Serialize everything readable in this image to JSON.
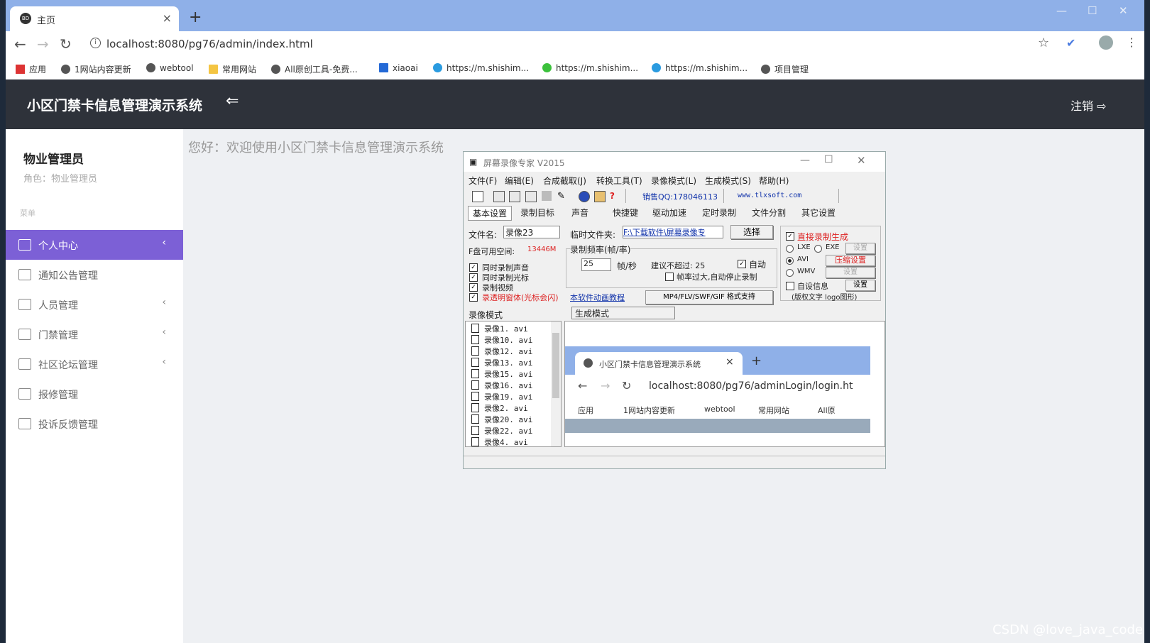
{
  "browser": {
    "tab_title": "主页",
    "tab_favicon": "BD",
    "url": "localhost:8080/pg76/admin/index.html",
    "bookmarks": [
      "应用",
      "1网站内容更新",
      "webtool",
      "常用网站",
      "All原创工具-免费...",
      "xiaoai",
      "https://m.shishim...",
      "https://m.shishim...",
      "https://m.shishim...",
      "项目管理"
    ]
  },
  "app": {
    "title": "小区门禁卡信息管理演示系统",
    "logout": "注销",
    "user_name": "物业管理员",
    "user_role": "角色：物业管理员",
    "menu_label": "菜单",
    "menu": [
      {
        "label": "个人中心",
        "chevron": true,
        "active": true
      },
      {
        "label": "通知公告管理",
        "chevron": false
      },
      {
        "label": "人员管理",
        "chevron": true
      },
      {
        "label": "门禁管理",
        "chevron": true
      },
      {
        "label": "社区论坛管理",
        "chevron": true
      },
      {
        "label": "报修管理",
        "chevron": false
      },
      {
        "label": "投诉反馈管理",
        "chevron": false
      }
    ],
    "welcome": "您好：欢迎使用小区门禁卡信息管理演示系统"
  },
  "recorder": {
    "title": "屏幕录像专家 V2015",
    "menus": [
      "文件(F)",
      "编辑(E)",
      "合成截取(J)",
      "转换工具(T)",
      "录像模式(L)",
      "生成模式(S)",
      "帮助(H)"
    ],
    "sales_qq": "销售QQ:178046113",
    "website": "www.tlxsoft.com",
    "tabs": [
      "基本设置",
      "录制目标",
      "声音",
      "快捷键",
      "驱动加速",
      "定时录制",
      "文件分割",
      "其它设置"
    ],
    "filename_label": "文件名:",
    "filename_value": "录像23",
    "temp_label": "临时文件夹:",
    "temp_value": "F:\\下载软件\\屏幕录像专",
    "select_btn": "选择",
    "disk_space": "F盘可用空间:",
    "disk_value": "13446M",
    "fps_group": "录制频率(帧/率)",
    "fps_value": "25",
    "fps_unit": "帧/秒",
    "fps_suggest": "建议不超过: 25",
    "auto": "自动",
    "auto_stop": "帧率过大,自动停止录制",
    "checks": [
      "同时录制声音",
      "同时录制光标",
      "录制视频",
      "录透明窗体(光标会闪)"
    ],
    "tutorial": "本软件动画教程",
    "formats": "MP4/FLV/SWF/GIF  格式支持",
    "direct": "直接录制生成",
    "opt_lxe": "LXE",
    "opt_exe": "EXE",
    "opt_avi": "AVI",
    "opt_wmv": "WMV",
    "settings": "设置",
    "compress": "压缩设置",
    "custom_info": "自设信息",
    "copyright": "(版权文字 logo图形)",
    "record_mode": "录像模式",
    "gen_mode": "生成模式",
    "files": [
      "录像1. avi",
      "录像10. avi",
      "录像12. avi",
      "录像13. avi",
      "录像15. avi",
      "录像16. avi",
      "录像19. avi",
      "录像2. avi",
      "录像20. avi",
      "录像22. avi",
      "录像4. avi"
    ]
  },
  "preview": {
    "tab_title": "小区门禁卡信息管理演示系统",
    "url": "localhost:8080/pg76/adminLogin/login.ht",
    "bookmarks": [
      "应用",
      "1网站内容更新",
      "webtool",
      "常用网站",
      "All原"
    ]
  },
  "watermark": "CSDN @love_java_code",
  "colors": {
    "accent": "#7c60d6",
    "header": "#2e323a",
    "chrome": "#8fb0e8"
  }
}
